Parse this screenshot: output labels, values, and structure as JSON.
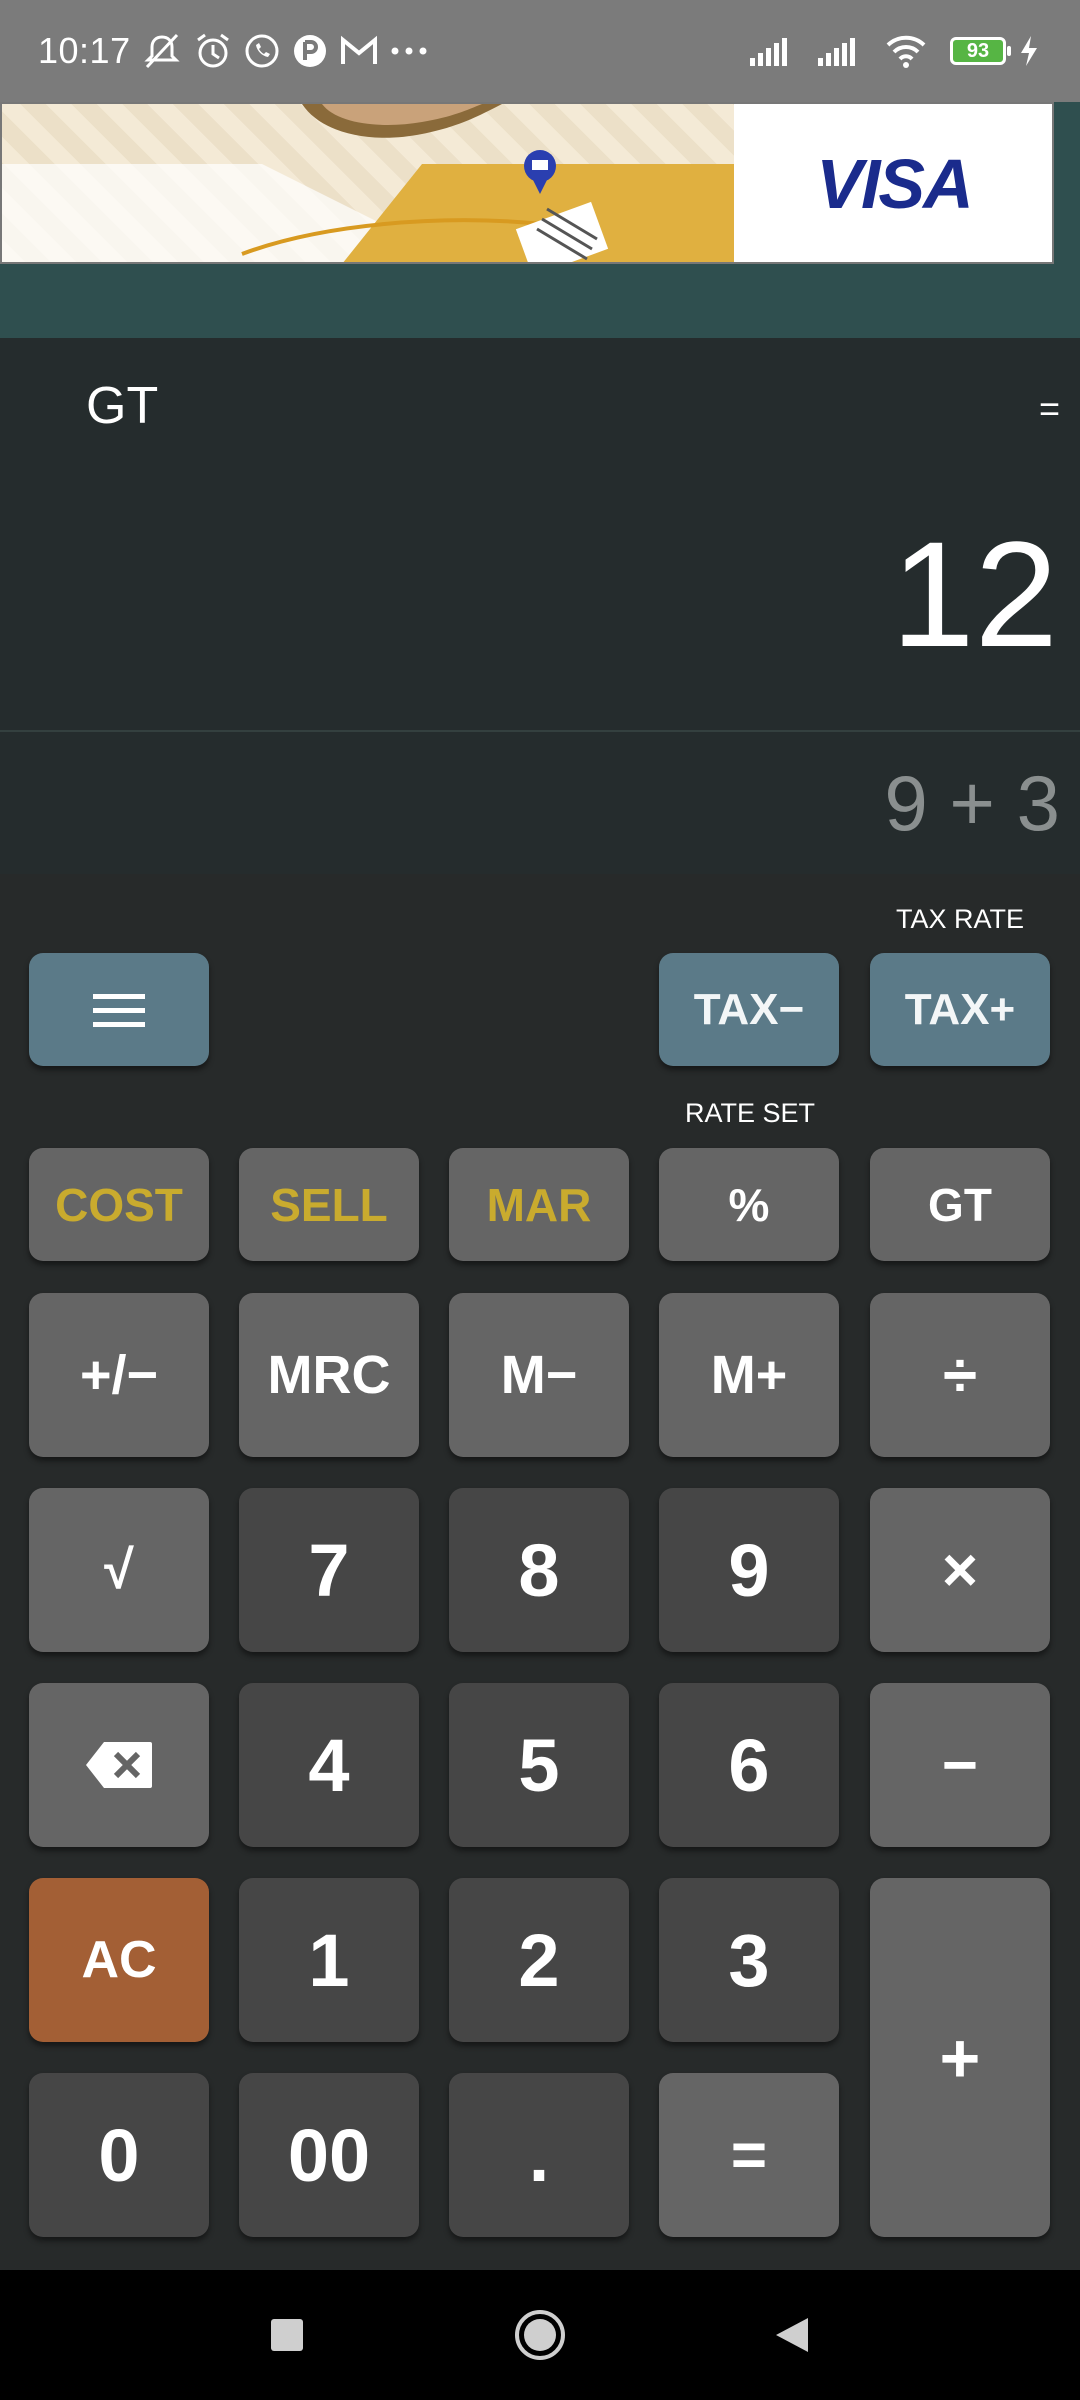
{
  "status_bar": {
    "time": "10:17",
    "notification_icons": [
      "notifications-off-icon",
      "alarm-icon",
      "whatsapp-icon",
      "app-icon",
      "gmail-icon",
      "more-dots-icon"
    ],
    "battery_level": "93",
    "signal_icons": [
      "signal-1-icon",
      "signal-2-icon",
      "wifi-icon",
      "charging-icon"
    ]
  },
  "ad": {
    "brand": "VISA"
  },
  "display": {
    "gt_indicator": "GT",
    "equals_indicator": "=",
    "value": "12",
    "expression": "9 + 3"
  },
  "keypad": {
    "tax_rate_label": "TAX RATE",
    "rate_set_label": "RATE SET",
    "menu_icon": "menu-icon",
    "tax_minus": "TAX−",
    "tax_plus": "TAX+",
    "cost": "COST",
    "sell": "SELL",
    "mar": "MAR",
    "percent": "%",
    "gt": "GT",
    "plus_minus": "+/−",
    "mrc": "MRC",
    "m_minus": "M−",
    "m_plus": "M+",
    "divide": "÷",
    "sqrt": "√",
    "seven": "7",
    "eight": "8",
    "nine": "9",
    "multiply": "×",
    "backspace_icon": "backspace-icon",
    "four": "4",
    "five": "5",
    "six": "6",
    "minus": "−",
    "ac": "AC",
    "one": "1",
    "two": "2",
    "three": "3",
    "plus": "+",
    "zero": "0",
    "double_zero": "00",
    "dot": ".",
    "equals": "="
  },
  "colors": {
    "status_bar": "#7b7b7b",
    "display_bg": "#252c2d",
    "ad_area_bg": "#2f4f4f",
    "keypad_bg": "#272a2a",
    "teal_key": "#5b7a88",
    "light_key": "#656565",
    "dark_key": "#464646",
    "gold_text": "#c9ab2e",
    "ac_key": "#a35f35"
  },
  "nav_bar": {
    "icons": [
      "recents-square-icon",
      "home-circle-icon",
      "back-triangle-icon"
    ]
  }
}
